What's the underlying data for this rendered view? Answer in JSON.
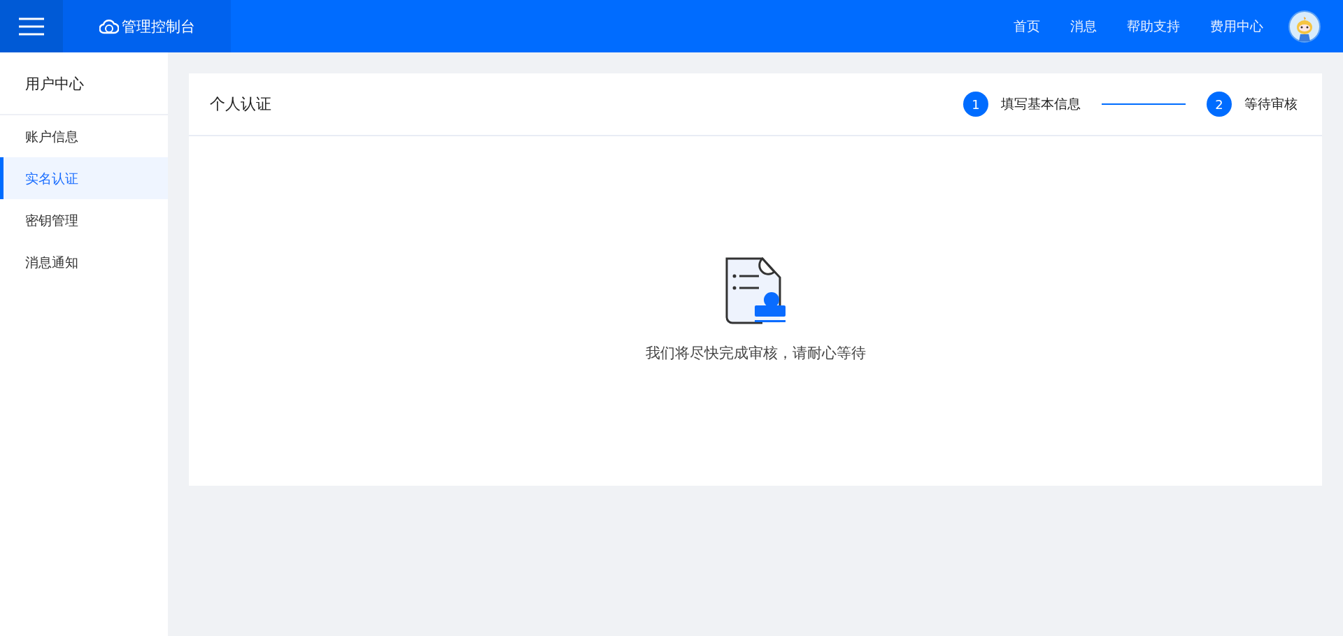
{
  "header": {
    "logo_text": "管理控制台",
    "nav": [
      {
        "label": "首页"
      },
      {
        "label": "消息"
      },
      {
        "label": "帮助支持"
      },
      {
        "label": "费用中心"
      }
    ]
  },
  "sidebar": {
    "title": "用户中心",
    "items": [
      {
        "label": "账户信息",
        "selected": false
      },
      {
        "label": "实名认证",
        "selected": true
      },
      {
        "label": "密钥管理",
        "selected": false
      },
      {
        "label": "消息通知",
        "selected": false
      }
    ]
  },
  "card": {
    "title": "个人认证",
    "steps": [
      {
        "number": "1",
        "label": "填写基本信息",
        "active": true
      },
      {
        "number": "2",
        "label": "等待审核",
        "active": true
      }
    ],
    "message": "我们将尽快完成审核，请耐心等待"
  }
}
